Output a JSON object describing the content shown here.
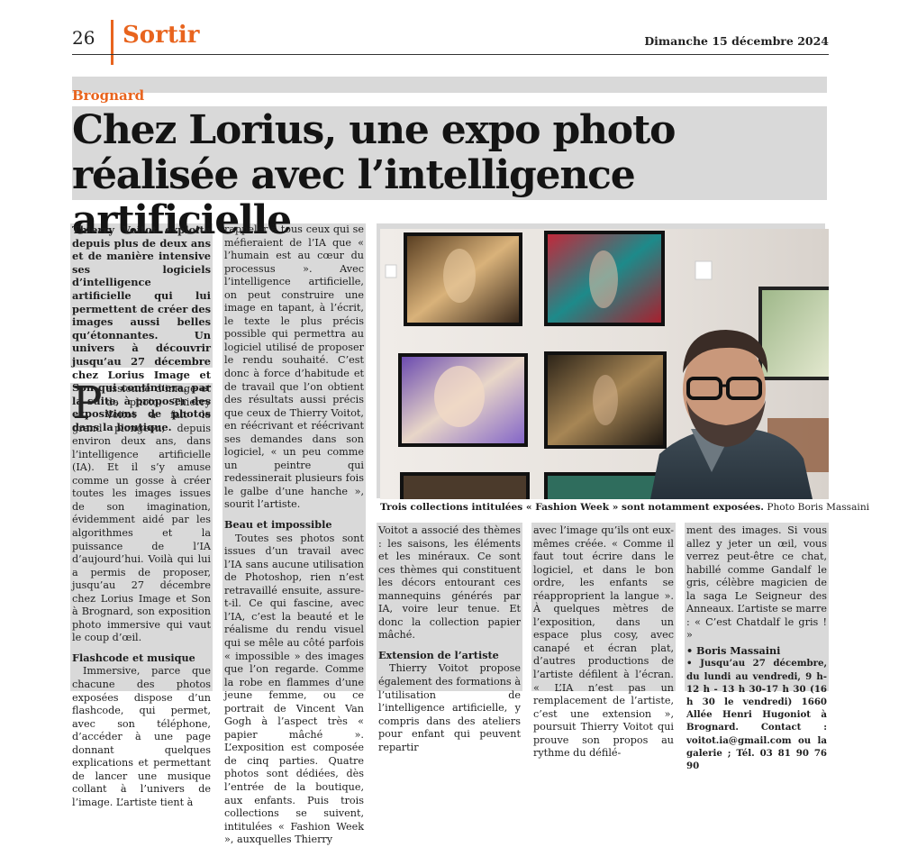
{
  "header": {
    "page_number": "26",
    "rubric": "Sortir",
    "date": "Dimanche 15 décembre 2024"
  },
  "article": {
    "kicker": "Brognard",
    "title": "Chez Lorius, une expo photo réalisée avec l’intelligence artificielle",
    "chapo": "Thierry Voitot exploite depuis plus de deux ans et de manière intensive ses logiciels d’intelligence artificielle qui lui permettent de créer des images aussi belles qu’étonnantes. Un univers à découvrir jusqu’au 27 décembre chez Lorius Image et Son qui continuera, par la suite, à proposer des expositions de photos dans la boutique.",
    "drop_cap": "P",
    "col1_p1": "assionné d’image et de photo, Thierry Voitot a fait le grand plongeon, depuis environ deux ans, dans l’intelligence artificielle (IA). Et il s’y amuse comme un gosse à créer toutes les images issues de son imagination, évidemment aidé par les algorithmes et la puissance de l’IA d’aujourd’hui. Voilà qui lui a permis de proposer, jusqu’au 27 décembre chez Lorius Image et Son à Brognard, son exposition photo immersive qui vaut le coup d’œil.",
    "sub1": "Flashcode et musique",
    "col1_p2": "Immersive, parce que chacune des photos exposées dispose d’un flashcode, qui permet, avec son téléphone, d’accéder à une page donnant quelques explications et permettant de lancer une musique collant à l’univers de l’image. L’artiste tient à",
    "col2_p1": "rappeler à tous ceux qui se méfieraient de l’IA que « l’humain est au cœur du processus ». Avec l’intelligence artificielle, on peut construire une image en tapant, à l’écrit, le texte le plus précis possible qui permettra au logiciel utilisé de proposer le rendu souhaité. C’est donc à force d’habitude et de travail que l’on obtient des résultats aussi précis que ceux de Thierry Voitot, en réécrivant et réécrivant ses demandes dans son logiciel, « un peu comme un peintre qui redessinerait plusieurs fois le galbe d’une hanche », sourit l’artiste.",
    "sub2": "Beau et impossible",
    "col2_p2": "Toutes ses photos sont issues d’un travail avec l’IA sans aucune utilisation de Photoshop, rien n’est retravaillé ensuite, assure-t-il. Ce qui fascine, avec l’IA, c’est la beauté et le réalisme du rendu visuel qui se mêle au côté parfois « impossible » des images que l’on regarde. Comme la robe en flammes d’une jeune femme, ou ce portrait de Vincent Van Gogh à l’aspect très « papier mâché ». L’exposition est composée de cinq parties. Quatre photos sont dédiées, dès l’entrée de la boutique, aux enfants. Puis trois collections se suivent, intitulées « Fashion Week », auxquelles Thierry",
    "caption_bold": "Trois collections intitulées « Fashion Week » sont notamment exposées.",
    "caption_credit": "Photo Boris Massaini",
    "col3_p1": "Voitot a associé des thèmes : les saisons, les éléments et les minéraux. Ce sont ces thèmes qui constituent les décors entourant ces mannequins générés par IA, voire leur tenue. Et donc la collection papier mâché.",
    "sub3": "Extension de l’artiste",
    "col3_p2": "Thierry Voitot propose également des formations à l’utilisation de l’intelligence artificielle, y compris dans des ateliers pour enfant qui peuvent repartir",
    "col4_p1": "avec l’image qu’ils ont eux-mêmes créée. « Comme il faut tout écrire dans le logiciel, et dans le bon ordre, les enfants se réapproprient la langue ». À quelques mètres de l’exposition, dans un espace plus cosy, avec canapé et écran plat, d’autres productions de l’artiste défilent à l’écran. « L’IA n’est pas un remplacement de l’artiste, c’est une extension », poursuit Thierry Voitot qui prouve son propos au rythme du défilé-",
    "col5_p1": "ment des images. Si vous allez y jeter un œil, vous verrez peut-être ce chat, habillé comme Gandalf le gris, célèbre magicien de la saga Le Seigneur des Anneaux. L’artiste se marre : « C’est Chatdalf le gris ! »",
    "author": "• Boris Massaini",
    "info": "• Jusqu’au 27 décembre, du lundi au vendredi, 9 h-12 h - 13 h 30-17 h 30 (16 h 30 le vendredi) 1660 Allée Henri Hugoniot à Brognard. Contact : voitot.ia@gmail.com ou la galerie ; Tél. 03 81 90 76 90"
  }
}
